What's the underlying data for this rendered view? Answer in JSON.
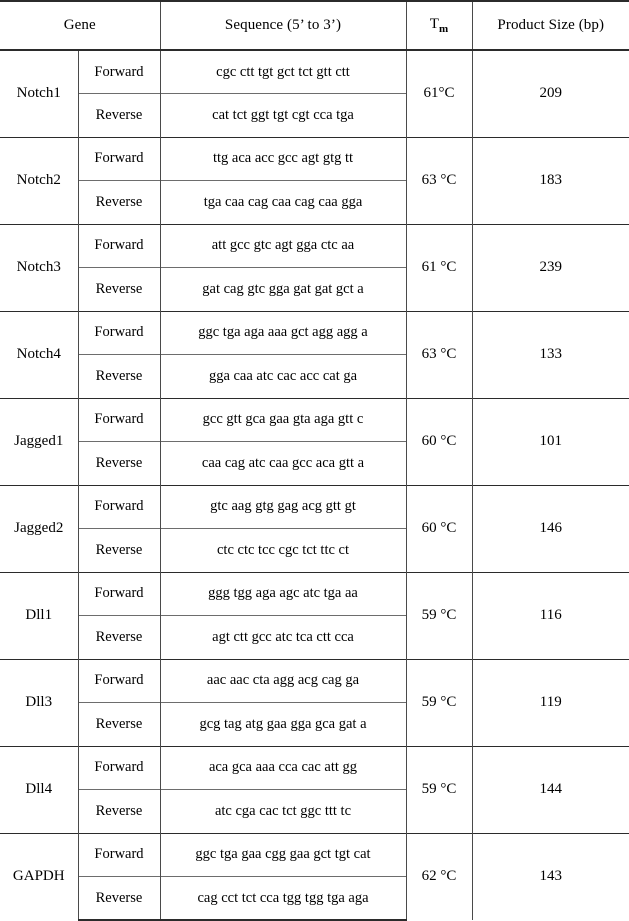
{
  "table": {
    "headers": {
      "gene": "Gene",
      "sequence": "Sequence (5’ to 3’)",
      "tm": "T",
      "tm_sub": "m",
      "product_size": "Product Size (bp)"
    },
    "direction_labels": {
      "forward": "Forward",
      "reverse": "Reverse"
    },
    "rows": [
      {
        "gene": "Notch1",
        "forward": "cgc ctt tgt gct tct gtt ctt",
        "reverse": "cat tct ggt tgt cgt cca tga",
        "tm": "61°C",
        "product_size": "209"
      },
      {
        "gene": "Notch2",
        "forward": "ttg aca acc gcc agt gtg tt",
        "reverse": "tga caa cag caa cag caa gga",
        "tm": "63 °C",
        "product_size": "183"
      },
      {
        "gene": "Notch3",
        "forward": "att gcc gtc agt gga ctc aa",
        "reverse": "gat cag gtc gga gat gat gct a",
        "tm": "61 °C",
        "product_size": "239"
      },
      {
        "gene": "Notch4",
        "forward": "ggc tga aga aaa gct agg agg a",
        "reverse": "gga caa atc cac acc cat ga",
        "tm": "63 °C",
        "product_size": "133"
      },
      {
        "gene": "Jagged1",
        "forward": "gcc gtt gca gaa gta aga gtt c",
        "reverse": "caa cag atc caa gcc aca gtt a",
        "tm": "60 °C",
        "product_size": "101"
      },
      {
        "gene": "Jagged2",
        "forward": "gtc aag gtg gag acg gtt gt",
        "reverse": "ctc ctc tcc cgc tct ttc ct",
        "tm": "60 °C",
        "product_size": "146"
      },
      {
        "gene": "Dll1",
        "forward": "ggg tgg aga agc atc tga aa",
        "reverse": "agt ctt gcc atc tca ctt cca",
        "tm": "59 °C",
        "product_size": "116"
      },
      {
        "gene": "Dll3",
        "forward": "aac aac cta agg acg cag ga",
        "reverse": "gcg tag atg gaa gga gca gat a",
        "tm": "59 °C",
        "product_size": "119"
      },
      {
        "gene": "Dll4",
        "forward": "aca gca aaa cca cac att gg",
        "reverse": "atc cga cac tct ggc ttt tc",
        "tm": "59 °C",
        "product_size": "144"
      },
      {
        "gene": "GAPDH",
        "forward": "ggc tga gaa cgg gaa gct tgt cat",
        "reverse": "cag cct tct cca tgg tgg tga aga",
        "tm": "62 °C",
        "product_size": "143"
      }
    ]
  }
}
